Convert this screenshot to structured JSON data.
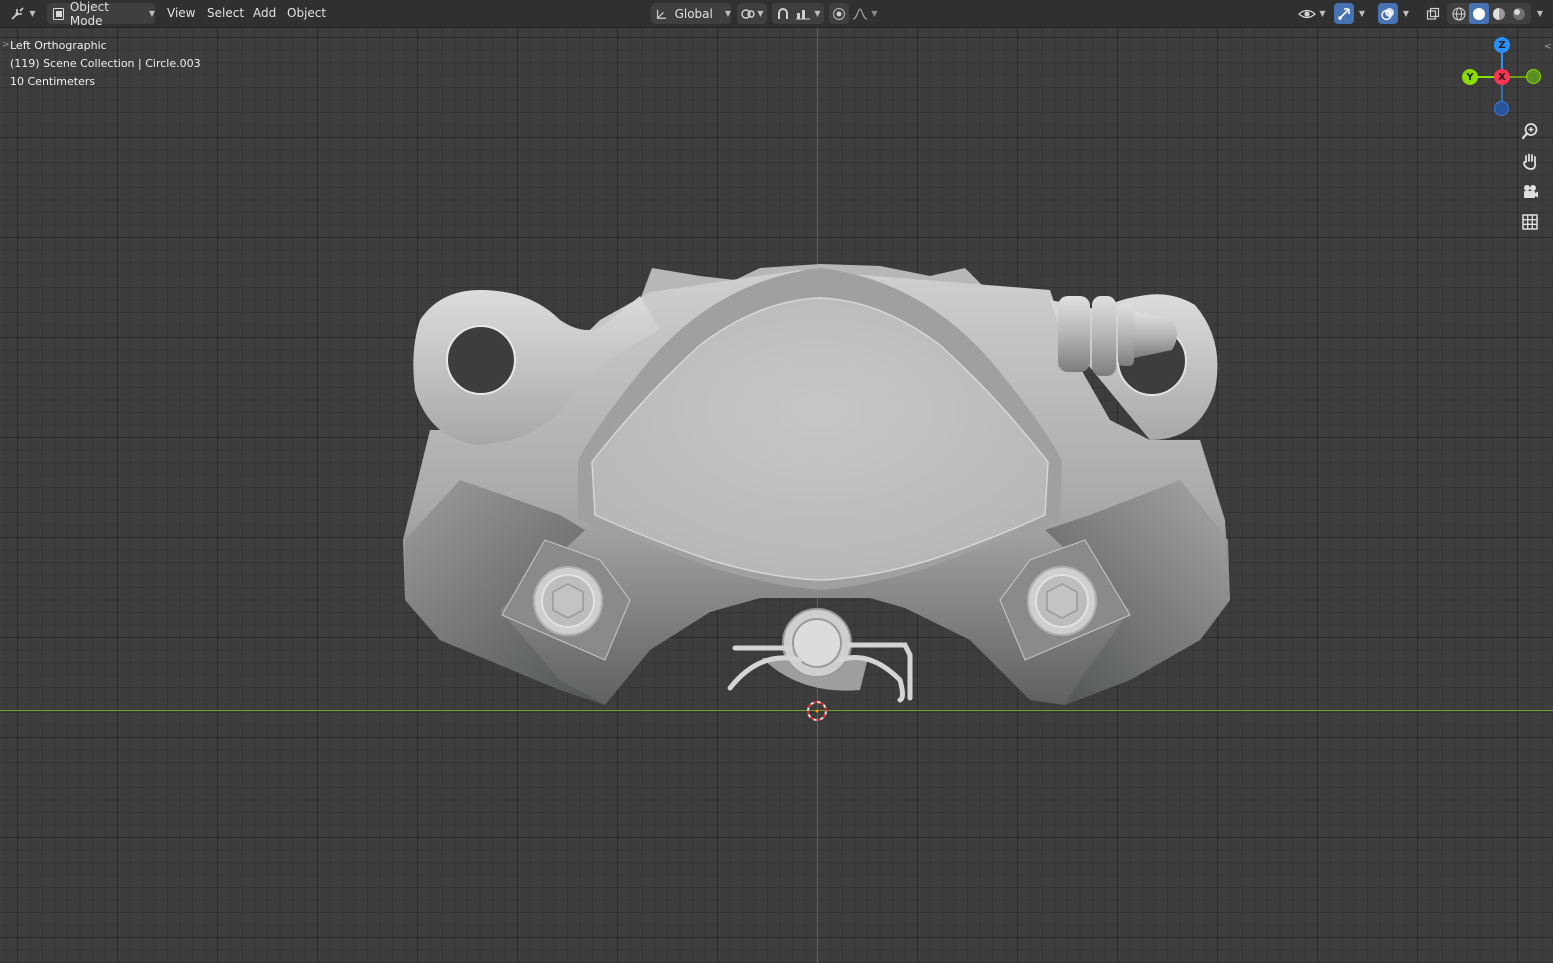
{
  "header": {
    "mode": "Object Mode",
    "menus": [
      "View",
      "Select",
      "Add",
      "Object"
    ],
    "orientation": "Global"
  },
  "viewport": {
    "view_name": "Left Orthographic",
    "collection": "(119) Scene Collection | Circle.003",
    "scale": "10 Centimeters"
  },
  "gizmo": {
    "z": "Z",
    "y": "Y",
    "x": "X"
  },
  "icons": {
    "header_left": [
      "editor-type-icon",
      "object-mode-icon"
    ],
    "header_center": [
      "transform-orientation-icon",
      "pivot-icon",
      "snap-icon",
      "snap-increment-icon",
      "proportional-edit-icon",
      "falloff-icon"
    ],
    "header_right": [
      "visibility-icon",
      "gizmo-icon",
      "overlay-icon",
      "xray-icon",
      "wireframe-shading-icon",
      "solid-shading-icon",
      "material-shading-icon",
      "rendered-shading-icon"
    ],
    "nav": [
      "zoom-icon",
      "pan-hand-icon",
      "camera-icon",
      "grid-icon"
    ]
  },
  "colors": {
    "header_bg": "#303030",
    "viewport_bg": "#3d3d3d",
    "x_axis": "#ff3352",
    "y_axis": "#8bdc00",
    "z_axis": "#2890ff",
    "active": "#4772b3"
  }
}
